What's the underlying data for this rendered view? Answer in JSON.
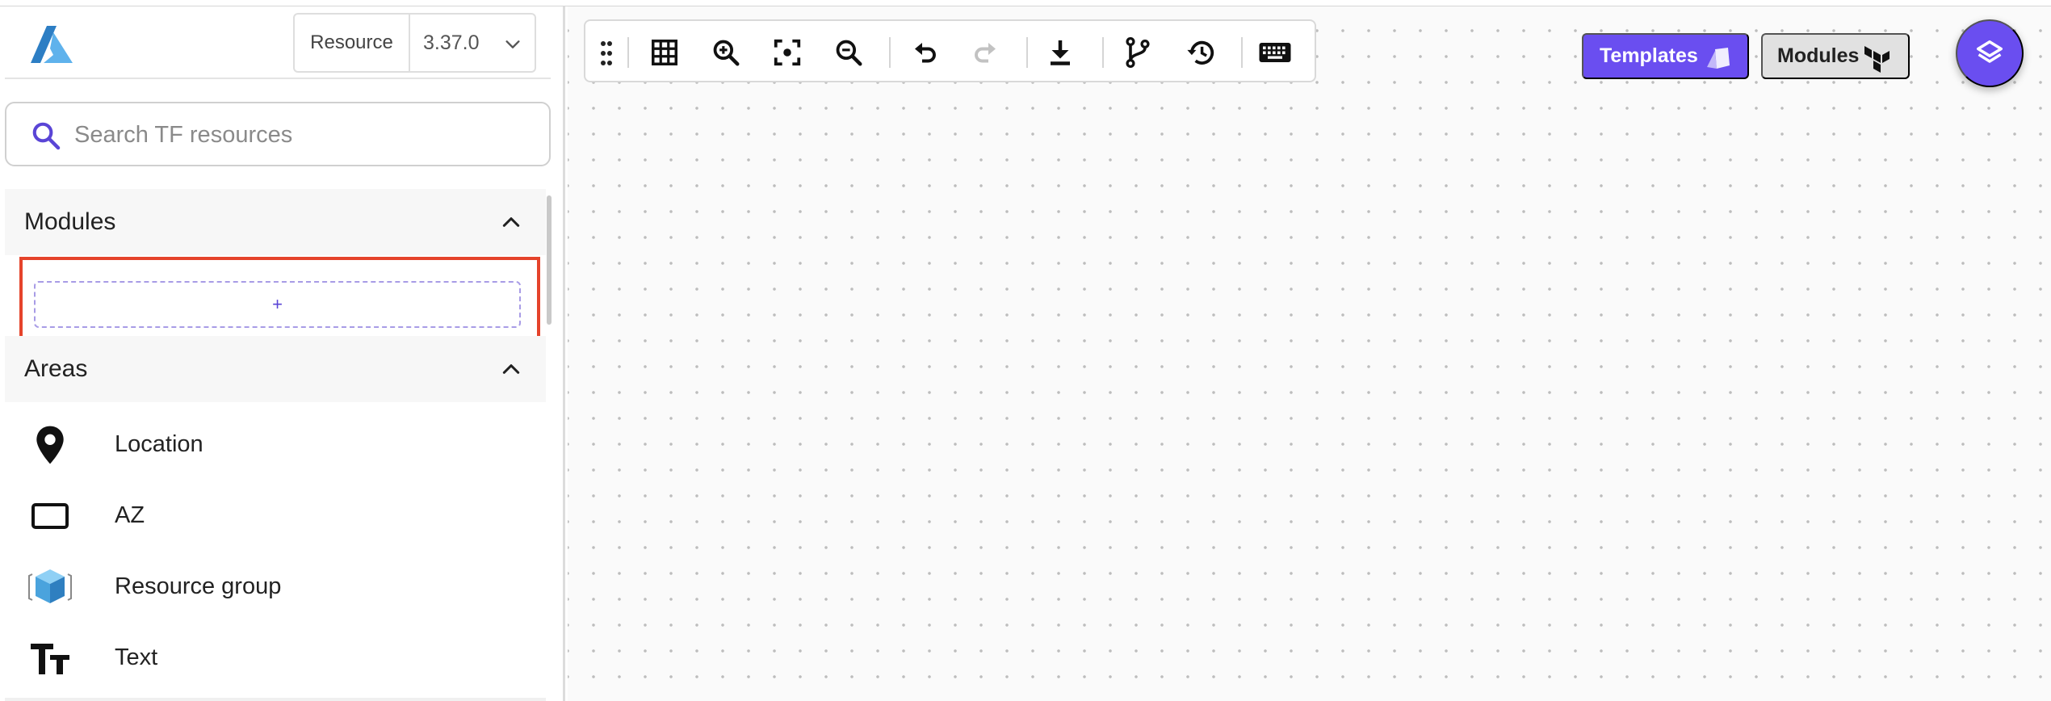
{
  "header": {
    "resource_label": "Resource",
    "version_value": "3.37.0"
  },
  "search": {
    "placeholder": "Search TF resources",
    "value": ""
  },
  "sections": {
    "modules": {
      "title": "Modules",
      "add_label": "+"
    },
    "areas": {
      "title": "Areas",
      "items": [
        {
          "label": "Location",
          "icon": "location-pin-icon"
        },
        {
          "label": "AZ",
          "icon": "rectangle-icon"
        },
        {
          "label": "Resource group",
          "icon": "cube-icon"
        },
        {
          "label": "Text",
          "icon": "text-format-icon"
        }
      ]
    }
  },
  "canvas": {
    "templates_label": "Templates",
    "modules_label": "Modules"
  },
  "colors": {
    "accent": "#6a4ef0",
    "highlight": "#e5432b"
  }
}
